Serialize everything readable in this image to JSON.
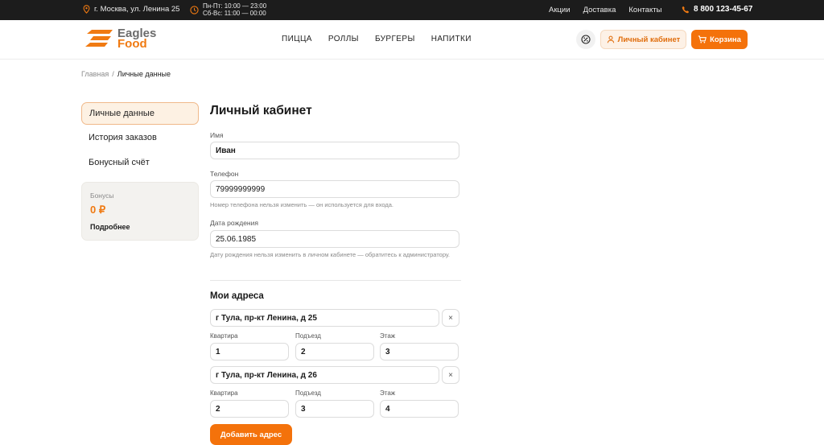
{
  "topbar": {
    "address": "г. Москва, ул. Ленина 25",
    "hours_weekdays": "Пн-Пт: 10:00 — 23:00",
    "hours_weekend": "Сб-Вс: 11:00 — 00:00",
    "links": [
      "Акции",
      "Доставка",
      "Контакты"
    ],
    "phone": "8 800 123-45-67"
  },
  "header": {
    "logo_line1": "Eagles",
    "logo_line2": "Food",
    "nav": [
      "ПИЦЦА",
      "РОЛЛЫ",
      "БУРГЕРЫ",
      "НАПИТКИ"
    ],
    "cabinet_label": "Личный кабинет",
    "cart_label": "Корзина"
  },
  "breadcrumb": {
    "home": "Главная",
    "separator": "/",
    "current": "Личные данные"
  },
  "sidebar": {
    "items": [
      {
        "label": "Личные данные",
        "active": true
      },
      {
        "label": "История заказов",
        "active": false
      },
      {
        "label": "Бонусный счёт",
        "active": false
      }
    ],
    "bonus": {
      "label": "Бонусы",
      "value": "0 ₽",
      "more": "Подробнее"
    }
  },
  "main": {
    "title": "Личный кабинет",
    "name_label": "Имя",
    "name_value": "Иван",
    "phone_label": "Телефон",
    "phone_value": "79999999999",
    "phone_hint": "Номер телефона нельзя изменить — он используется для входа.",
    "birth_label": "Дата рождения",
    "birth_value": "25.06.1985",
    "birth_hint": "Дату рождения нельзя изменить в личном кабинете — обратитесь к администратору.",
    "addresses_title": "Мои адреса",
    "addresses": [
      {
        "address": "г Тула, пр-кт Ленина, д 25",
        "apt_label": "Квартира",
        "apt": "1",
        "entrance_label": "Подъезд",
        "entrance": "2",
        "floor_label": "Этаж",
        "floor": "3"
      },
      {
        "address": "г Тула, пр-кт Ленина, д 26",
        "apt_label": "Квартира",
        "apt": "2",
        "entrance_label": "Подъезд",
        "entrance": "3",
        "floor_label": "Этаж",
        "floor": "4"
      }
    ],
    "remove_symbol": "×",
    "add_address_label": "Добавить адрес"
  },
  "colors": {
    "accent": "#f4720b",
    "topbar_bg": "#1c1c1c"
  }
}
